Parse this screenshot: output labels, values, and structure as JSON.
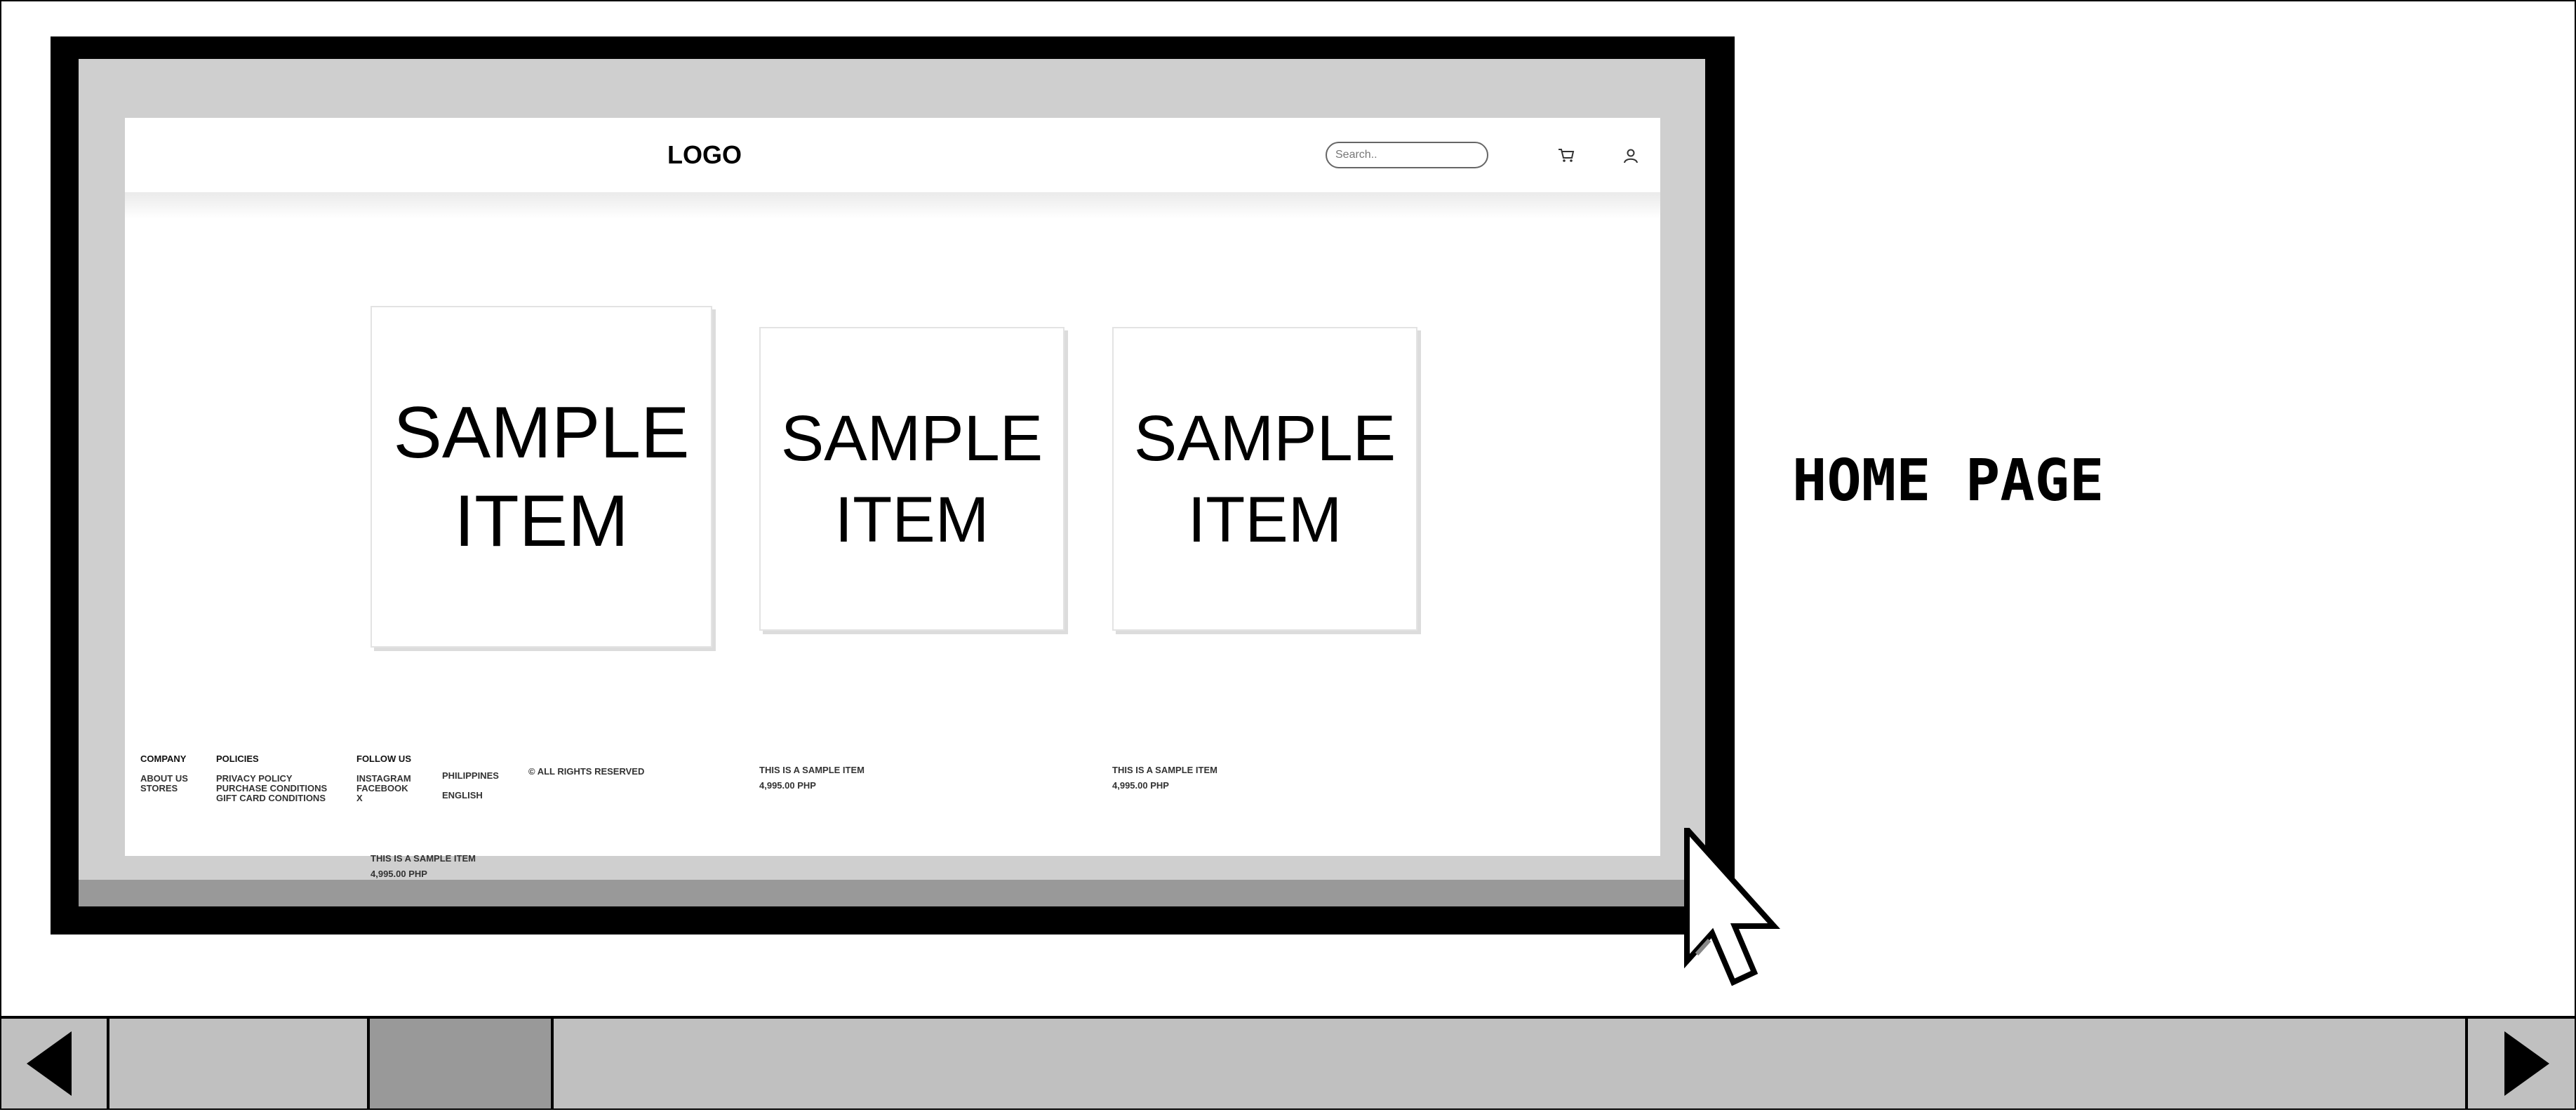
{
  "site": {
    "logo": "LOGO",
    "search_placeholder": "Search..",
    "cart_icon": "cart-icon",
    "user_icon": "user-icon"
  },
  "products": [
    {
      "image_line1": "SAMPLE",
      "image_line2": "ITEM",
      "name": "THIS IS A SAMPLE ITEM",
      "price": "4,995.00 PHP"
    },
    {
      "image_line1": "SAMPLE",
      "image_line2": "ITEM",
      "name": "THIS IS A SAMPLE ITEM",
      "price": "4,995.00 PHP"
    },
    {
      "image_line1": "SAMPLE",
      "image_line2": "ITEM",
      "name": "THIS IS A SAMPLE ITEM",
      "price": "4,995.00 PHP"
    }
  ],
  "footer": {
    "company": {
      "heading": "COMPANY",
      "links": [
        "ABOUT US",
        "STORES"
      ]
    },
    "policies": {
      "heading": "POLICIES",
      "links": [
        "PRIVACY POLICY",
        "PURCHASE CONDITIONS",
        "GIFT CARD CONDITIONS"
      ]
    },
    "follow": {
      "heading": "FOLLOW US",
      "links": [
        "INSTAGRAM",
        "FACEBOOK",
        "X"
      ]
    },
    "region": {
      "country": "PHILIPPINES",
      "language": "ENGLISH"
    },
    "copyright": "© ALL RIGHTS RESERVED"
  },
  "page_label": "HOME PAGE",
  "colors": {
    "frame": "#000000",
    "bezel_gray": "#cfcfcf",
    "shadow_gray": "#999999",
    "scrollbar": "#c0c0c0"
  },
  "scrollbar": {
    "left_icon": "arrow-left-icon",
    "right_icon": "arrow-right-icon"
  }
}
